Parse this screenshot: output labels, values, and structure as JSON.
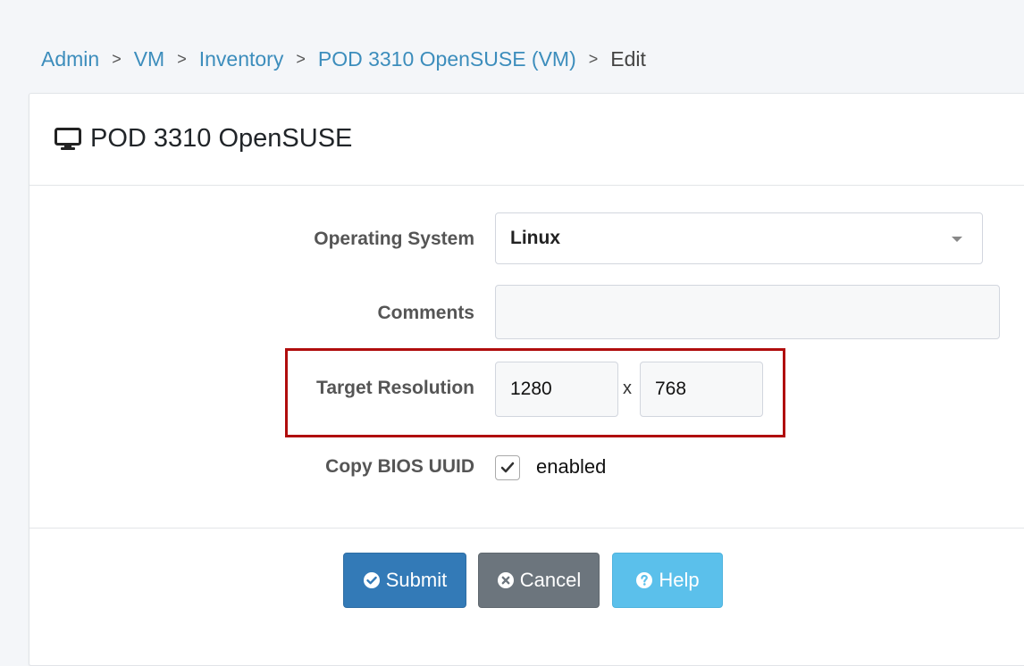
{
  "breadcrumb": {
    "items": [
      "Admin",
      "VM",
      "Inventory",
      "POD 3310 OpenSUSE (VM)"
    ],
    "current": "Edit",
    "separator": ">"
  },
  "card": {
    "title": "POD 3310 OpenSUSE",
    "title_icon": "desktop-icon"
  },
  "form": {
    "os_label": "Operating System",
    "os_value": "Linux",
    "comments_label": "Comments",
    "comments_value": "",
    "resolution_label": "Target Resolution",
    "resolution_width": "1280",
    "resolution_x": "x",
    "resolution_height": "768",
    "bios_label": "Copy BIOS UUID",
    "bios_checked": true,
    "bios_check_label": "enabled"
  },
  "buttons": {
    "submit": "Submit",
    "cancel": "Cancel",
    "help": "Help"
  },
  "colors": {
    "link": "#3c8dbc",
    "submit": "#337ab7",
    "cancel": "#6c757d",
    "help": "#5bc0eb",
    "highlight": "#b00d0d"
  }
}
